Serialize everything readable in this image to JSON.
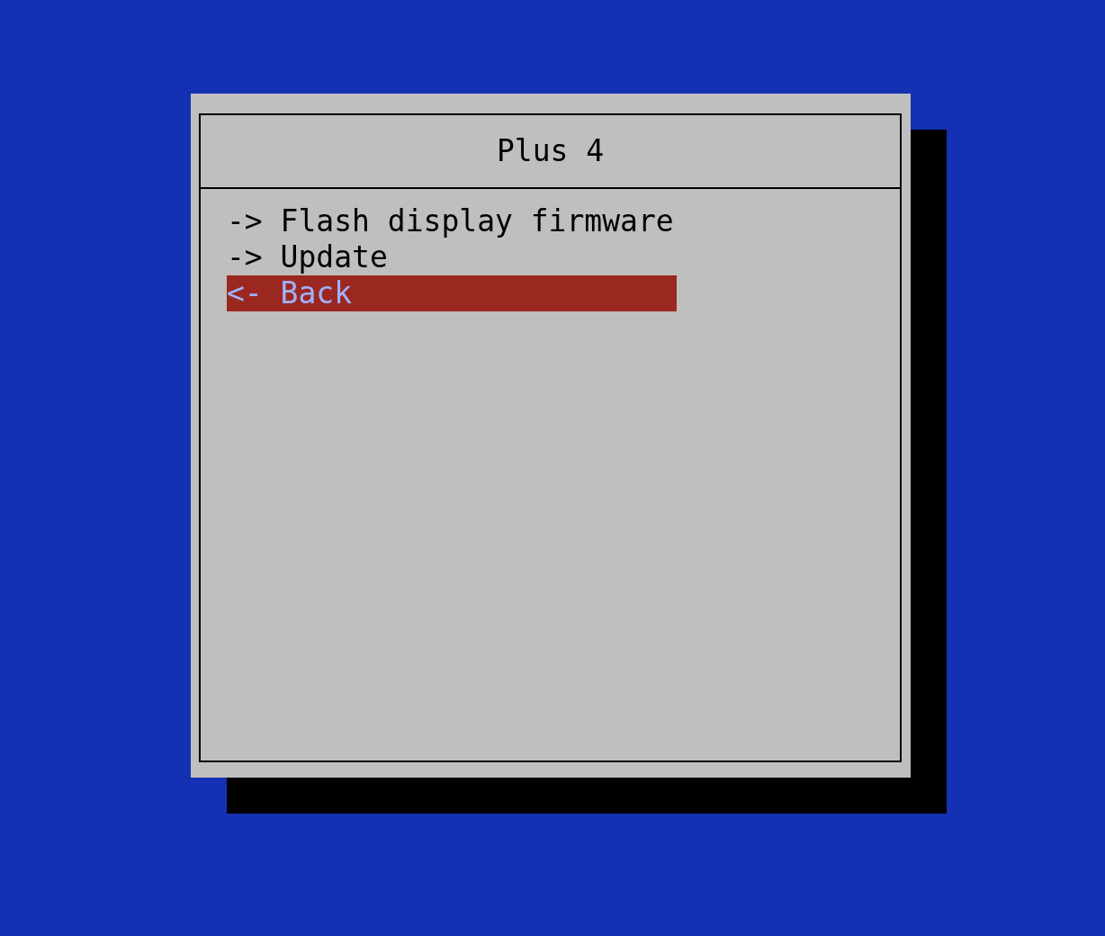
{
  "dialog": {
    "title": "Plus 4",
    "menu": [
      {
        "label": "-> Flash display firmware",
        "selected": false
      },
      {
        "label": "-> Update",
        "selected": false
      },
      {
        "label": "<- Back",
        "selected": true
      }
    ]
  }
}
